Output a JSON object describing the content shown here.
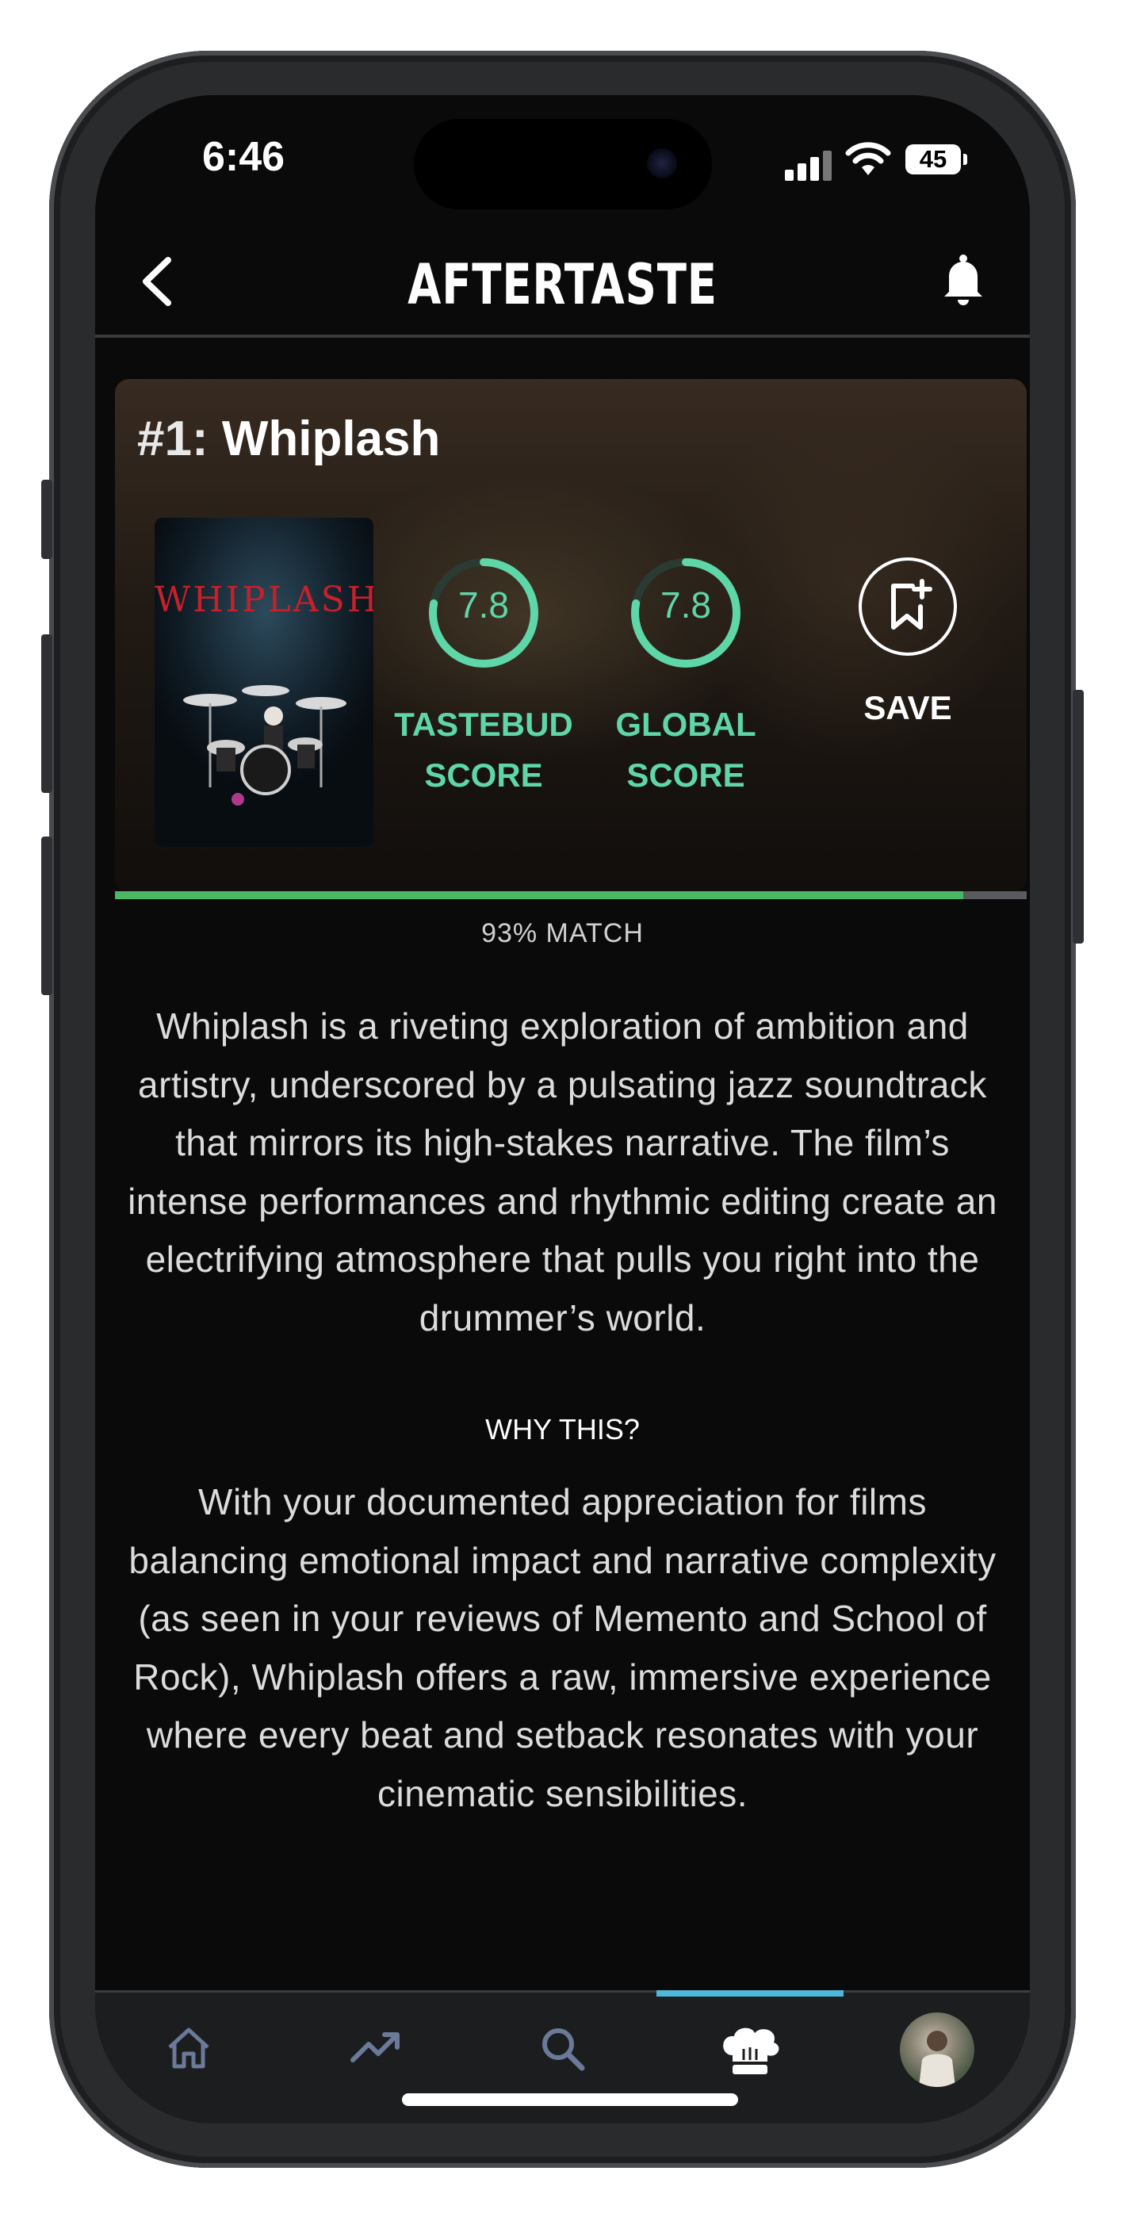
{
  "status_bar": {
    "time": "6:46",
    "battery": "45"
  },
  "header": {
    "title": "AFTERTASTE",
    "back_icon": "chevron-left-icon",
    "bell_icon": "bell-icon"
  },
  "card": {
    "rank": "#1:",
    "movie_title": "Whiplash",
    "poster_title": "WHIPLASH",
    "tastebud": {
      "value": "7.8",
      "label_line1": "TASTEBUD",
      "label_line2": "SCORE",
      "fraction": 0.78
    },
    "global": {
      "value": "7.8",
      "label_line1": "GLOBAL",
      "label_line2": "SCORE",
      "fraction": 0.78
    },
    "save": {
      "label": "SAVE",
      "icon": "bookmark-plus-icon"
    }
  },
  "match": {
    "text": "93% MATCH",
    "percent": 93
  },
  "description": "Whiplash is a riveting exploration of ambition and artistry, underscored by a pulsating jazz soundtrack that mirrors its high-stakes narrative. The film’s intense performances and rhythmic editing create an electrifying atmosphere that pulls you right into the drummer’s world.",
  "why": {
    "title": "WHY THIS?",
    "text": "With your documented appreciation for films balancing emotional impact and narrative complexity (as seen in your reviews of Memento and School of Rock), Whiplash offers a raw, immersive experience where every beat and setback resonates with your cinematic sensibilities."
  },
  "tabs": [
    {
      "name": "home",
      "icon": "home-icon"
    },
    {
      "name": "trending",
      "icon": "trending-up-icon"
    },
    {
      "name": "search",
      "icon": "search-icon"
    },
    {
      "name": "chef",
      "icon": "chef-hat-icon",
      "active": true
    },
    {
      "name": "profile",
      "icon": "avatar"
    }
  ],
  "colors": {
    "accent": "#5fd6a8",
    "match": "#4bb866",
    "active_tab": "#4fb7d9",
    "poster_title": "#c8202a"
  }
}
